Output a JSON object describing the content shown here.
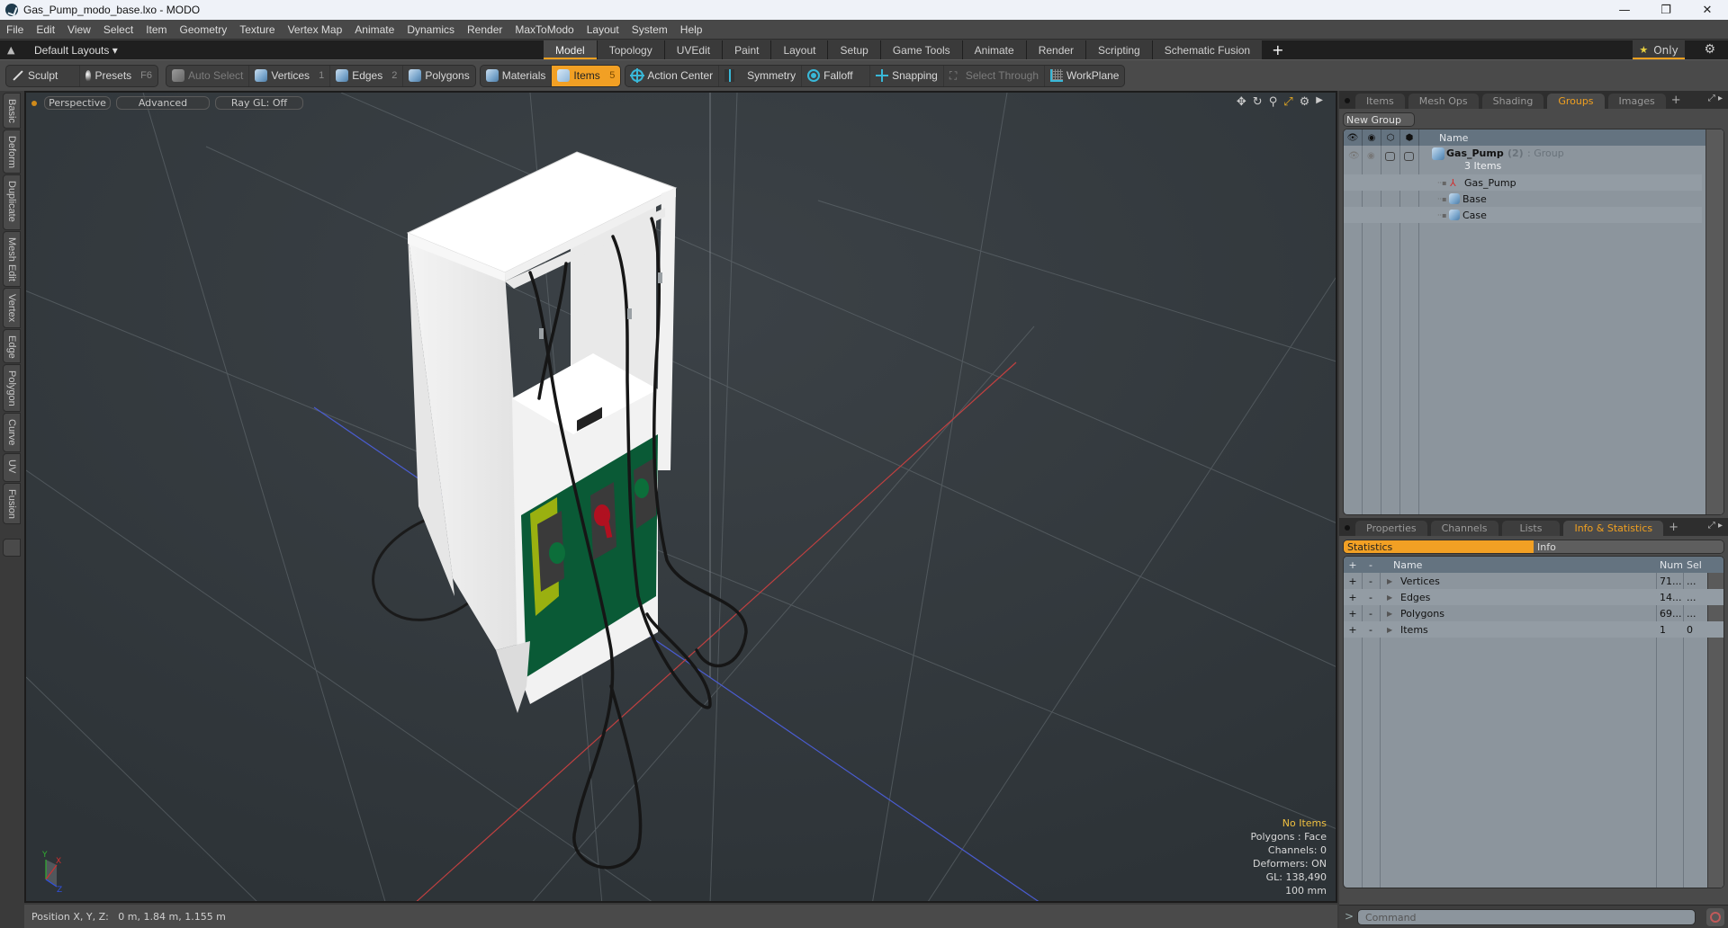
{
  "window": {
    "title": "Gas_Pump_modo_base.lxo - MODO",
    "controls": [
      "minimize",
      "restore",
      "close"
    ]
  },
  "menu": [
    "File",
    "Edit",
    "View",
    "Select",
    "Item",
    "Geometry",
    "Texture",
    "Vertex Map",
    "Animate",
    "Dynamics",
    "Render",
    "MaxToModo",
    "Layout",
    "System",
    "Help"
  ],
  "layoutbar": {
    "layouts_label": "Default Layouts ▾",
    "tabs": [
      "Model",
      "Topology",
      "UVEdit",
      "Paint",
      "Layout",
      "Setup",
      "Game Tools",
      "Animate",
      "Render",
      "Scripting",
      "Schematic Fusion"
    ],
    "active_tab": "Model",
    "only_label": "Only"
  },
  "toolbar": {
    "sculpt": "Sculpt",
    "presets": "Presets",
    "presets_key": "F6",
    "auto_select": "Auto Select",
    "vertices": "Vertices",
    "vertices_key": "1",
    "edges": "Edges",
    "edges_key": "2",
    "polygons": "Polygons",
    "materials": "Materials",
    "items": "Items",
    "items_key": "5",
    "action_center": "Action Center",
    "symmetry": "Symmetry",
    "falloff": "Falloff",
    "snapping": "Snapping",
    "select_through": "Select Through",
    "workplane": "WorkPlane"
  },
  "left_tabs": [
    "Basic",
    "Deform",
    "Duplicate",
    "Mesh Edit",
    "Vertex",
    "Edge",
    "Polygon",
    "Curve",
    "UV",
    "Fusion"
  ],
  "viewport": {
    "view_mode": "Perspective",
    "shading": "Advanced",
    "raygl": "Ray GL: Off",
    "info": {
      "selection": "No Items",
      "polygons": "Polygons : Face",
      "channels": "Channels: 0",
      "deformers": "Deformers: ON",
      "gl": "GL: 138,490",
      "grid": "100 mm"
    },
    "axis_labels": {
      "x": "X",
      "y": "Y",
      "z": "Z"
    }
  },
  "statusbar": {
    "position": "Position X, Y, Z:   0 m, 1.84 m, 1.155 m"
  },
  "groups_panel": {
    "tabs": [
      "Items",
      "Mesh Ops",
      "Shading",
      "Groups",
      "Images"
    ],
    "active_tab": "Groups",
    "new_group": "New Group",
    "column_name": "Name",
    "group": {
      "name": "Gas_Pump",
      "count": "(2)",
      "type": ": Group",
      "subtitle": "3 Items"
    },
    "children": [
      {
        "name": "Gas_Pump",
        "icon": "locator-icon"
      },
      {
        "name": "Base",
        "icon": "mesh-icon"
      },
      {
        "name": "Case",
        "icon": "mesh-icon"
      }
    ]
  },
  "stats_panel": {
    "tabs": [
      "Properties",
      "Channels",
      "Lists",
      "Info & Statistics"
    ],
    "active_tab": "Info & Statistics",
    "subtabs": [
      "Statistics",
      "Info"
    ],
    "columns": {
      "plus": "+",
      "minus": "-",
      "name": "Name",
      "num": "Num",
      "sel": "Sel"
    },
    "rows": [
      {
        "name": "Vertices",
        "num": "71...",
        "sel": "..."
      },
      {
        "name": "Edges",
        "num": "14...",
        "sel": "..."
      },
      {
        "name": "Polygons",
        "num": "69...",
        "sel": "..."
      },
      {
        "name": "Items",
        "num": "1",
        "sel": "0"
      }
    ]
  },
  "command": {
    "prompt": ">",
    "placeholder": "Command"
  }
}
